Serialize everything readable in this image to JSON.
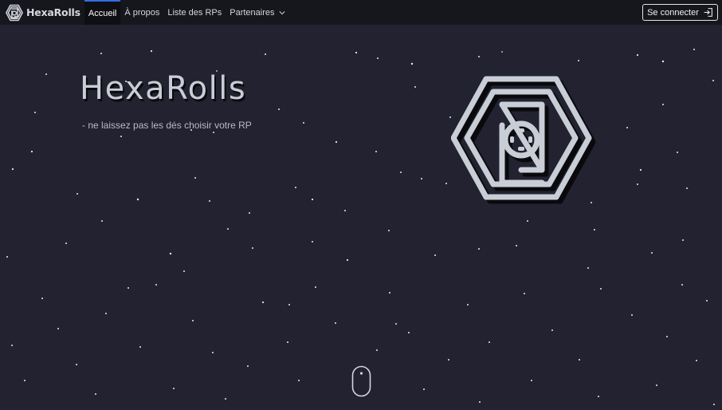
{
  "navbar": {
    "brand": "HexaRolls",
    "links": [
      {
        "label": "Accueil"
      },
      {
        "label": "À propos"
      },
      {
        "label": "Liste des RPs"
      },
      {
        "label": "Partenaires"
      }
    ],
    "login_label": "Se connecter"
  },
  "hero": {
    "title": "HexaRolls",
    "tagline": "-  ne laissez pas les dés choisir votre RP"
  },
  "colors": {
    "background": "#222230",
    "navbar": "#16161d",
    "accent": "#2f6fe0",
    "logo": "#c9ced6"
  },
  "icons": {
    "brand": "hexarolls-logo-icon",
    "dropdown": "chevron-down-icon",
    "login": "sign-in-icon",
    "scroll": "mouse-scroll-icon"
  }
}
